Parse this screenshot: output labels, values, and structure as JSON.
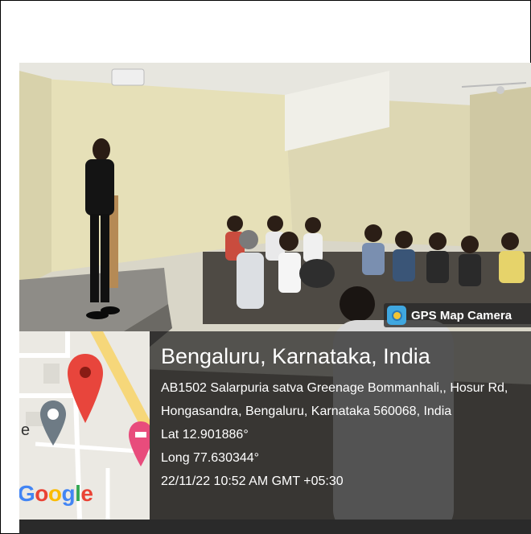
{
  "badge": {
    "label": "GPS Map Camera",
    "icon": "gps-map-camera-icon"
  },
  "location": {
    "title": "Bengaluru, Karnataka, India",
    "address": "AB1502 Salarpuria satva Greenage Bommanhali,, Hosur Rd, Hongasandra, Bengaluru, Karnataka 560068, India",
    "lat": "Lat 12.901886°",
    "long": "Long 77.630344°",
    "datetime": "22/11/22 10:52 AM GMT +05:30"
  },
  "map": {
    "watermark_letters": [
      "G",
      "o",
      "o",
      "g",
      "l",
      "e"
    ],
    "partial_label": "e"
  },
  "colors": {
    "pin": "#e8453c",
    "overlay": "#1e1e1e",
    "badge_logo": "#3fa7e0"
  }
}
